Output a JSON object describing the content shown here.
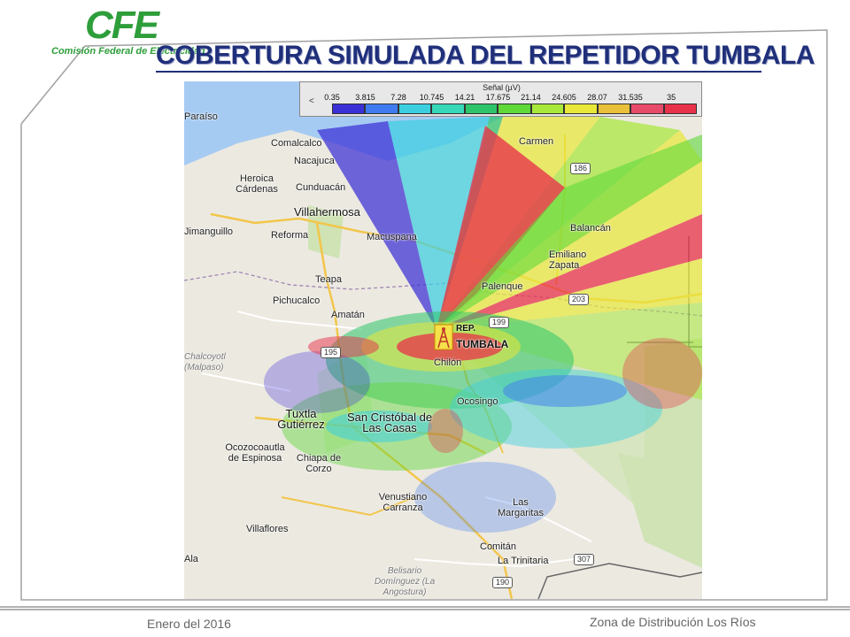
{
  "logo": {
    "mark": "CFE",
    "subtitle": "Comisión Federal de Electricidad"
  },
  "title": "COBERTURA SIMULADA DEL REPETIDOR TUMBALA",
  "legend": {
    "title": "Señal (µV)",
    "arrow": "<",
    "values": [
      "0.35",
      "3.815",
      "7.28",
      "10.745",
      "14.21",
      "17.675",
      "21.14",
      "24.605",
      "28.07",
      "31.535",
      "35"
    ],
    "colors": [
      "#3b2fd6",
      "#3f7bf0",
      "#3ccfe0",
      "#36d8b8",
      "#2ec46a",
      "#5fd83a",
      "#a8e83a",
      "#e8e83a",
      "#e8c03a",
      "#e84a6a",
      "#e8324a"
    ]
  },
  "map": {
    "places": [
      "Paraíso",
      "Comalcalco",
      "Nacajuca",
      "Heroica Cárdenas",
      "Cunduacán",
      "Villahermosa",
      "Jimanguillo",
      "Reforma",
      "Macuspana",
      "Teapa",
      "Pichucalco",
      "Amatán",
      "Chalcoyotl (Malpaso)",
      "Tuxtla Gutiérrez",
      "San Cristóbal de Las Casas",
      "Ocozocoautla de Espinosa",
      "Chiapa de Corzo",
      "Chilón",
      "Ocosingo",
      "Palenque",
      "Emiliano Zapata",
      "Balancán",
      "Carmen",
      "Venustiano Carranza",
      "Las Margaritas",
      "Villaflores",
      "Comitán",
      "La Trinitaria",
      "Belisario Domínguez (La Angostura)",
      "Ala"
    ],
    "highways": [
      "186",
      "203",
      "199",
      "195",
      "190",
      "307"
    ],
    "repeater": {
      "line1": "REP.",
      "line2": "TUMBALA"
    }
  },
  "footer": {
    "left": "Enero del 2016",
    "right": "Zona de Distribución Los Ríos"
  }
}
